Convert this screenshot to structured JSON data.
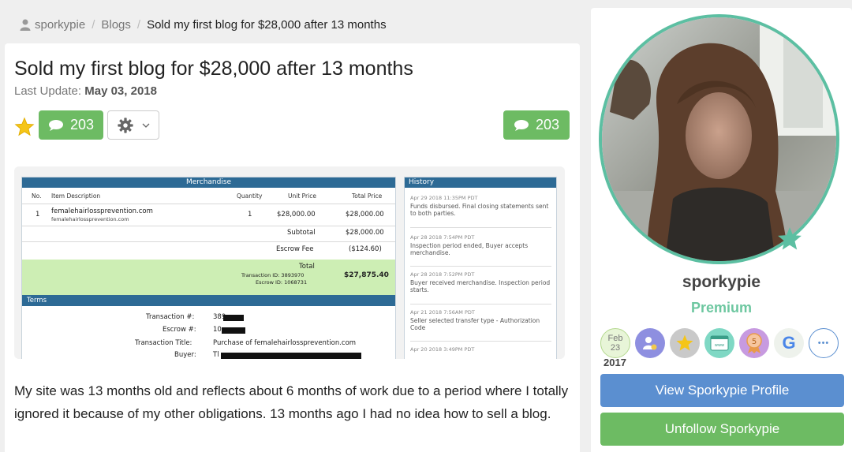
{
  "breadcrumb": {
    "user": "sporkypie",
    "section": "Blogs",
    "current": "Sold my first blog for $28,000 after 13 months"
  },
  "post": {
    "title": "Sold my first blog for $28,000 after 13 months",
    "last_update_label": "Last Update:",
    "last_update_date": "May 03, 2018",
    "comment_count": "203",
    "comment_count_right": "203",
    "body": "My site was 13 months old and reflects about 6 months of work due to a period where I totally ignored it because of my other obligations. 13 months ago I had no idea how to sell a blog."
  },
  "escrow": {
    "merch_header": "Merchandise",
    "columns": {
      "no": "No.",
      "item": "Item Description",
      "qty": "Quantity",
      "unit": "Unit Price",
      "total": "Total Price"
    },
    "item": {
      "no": "1",
      "name": "femalehairlossprevention.com",
      "sub": "femalehairlossprevention.com",
      "qty": "1",
      "unit": "$28,000.00",
      "total": "$28,000.00"
    },
    "subtotal_label": "Subtotal",
    "subtotal": "$28,000.00",
    "fee_label": "Escrow Fee",
    "fee": "($124.60)",
    "total_label": "Total",
    "total": "$27,875.40",
    "transaction_id": "Transaction ID: 3893970",
    "escrow_id": "Escrow ID: 1068731",
    "terms_header": "Terms",
    "terms": {
      "transaction_label": "Transaction #:",
      "transaction_val": "389",
      "escrow_label": "Escrow #:",
      "escrow_val": "10",
      "title_label": "Transaction Title:",
      "title_val": "Purchase of femalehairlossprevention.com",
      "buyer_label": "Buyer:",
      "buyer_val": "Tl"
    },
    "history_header": "History",
    "history": [
      {
        "date": "Apr 29 2018 11:35PM PDT",
        "text": "Funds disbursed. Final closing statements sent to both parties."
      },
      {
        "date": "Apr 28 2018 7:54PM PDT",
        "text": "Inspection period ended, Buyer accepts merchandise."
      },
      {
        "date": "Apr 28 2018 7:52PM PDT",
        "text": "Buyer received merchandise. Inspection period starts."
      },
      {
        "date": "Apr 21 2018 7:56AM PDT",
        "text": "Seller selected transfer type - Authorization Code"
      },
      {
        "date": "Apr 20 2018 3:49PM PDT",
        "text": ""
      }
    ]
  },
  "sidebar": {
    "username": "sporkypie",
    "membership": "Premium",
    "join_badge": {
      "month": "Feb",
      "day": "23",
      "year": "2017"
    },
    "badge_g": "G",
    "badge_five": "5",
    "more_label": "•••",
    "view_profile": "View Sporkypie Profile",
    "unfollow": "Unfollow Sporkypie"
  },
  "colors": {
    "green": "#6dbb63",
    "blue": "#5b8fd0",
    "teal": "#5cbfa2",
    "escrow_blue": "#2d6a95"
  }
}
